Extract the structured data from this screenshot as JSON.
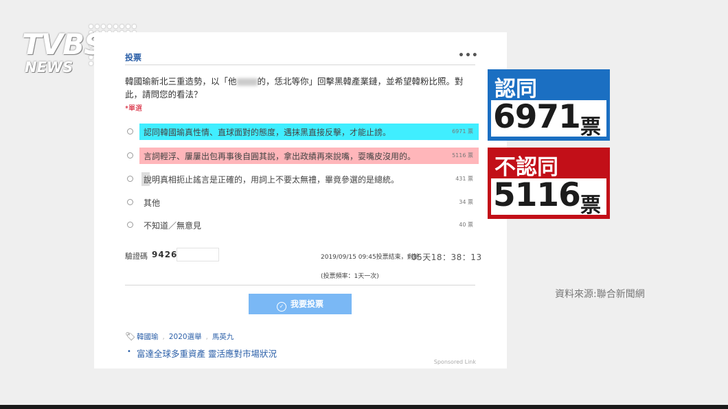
{
  "logo": {
    "top": "TVBS",
    "bottom": "NEWS"
  },
  "poll": {
    "title": "投票",
    "more_icon": "more-icon",
    "question_part1": "韓國瑜新北三重造勢，以「他",
    "question_part2": "的，恁北等你」回擊黑韓產業鏈，並希望韓粉比照。對此，請問您的看法？",
    "single_choice_note": "*單選",
    "options": [
      {
        "label": "認同韓國瑜真性情、直球面對的態度，遇抹黑直接反擊，才能止謗。",
        "count": "6971 票"
      },
      {
        "label": "言詞輕浮、屢屢出包再事後自圓其說，拿出政績再來說嘴，耍嘴皮沒用的。",
        "count": "5116 票"
      },
      {
        "label": "說明真相扼止謠言是正確的，用詞上不要太無禮，畢竟參選的是總統。",
        "count": "431 票"
      },
      {
        "label": "其他",
        "count": "34 票"
      },
      {
        "label": "不知道／無意見",
        "count": "40 票"
      }
    ],
    "verify_label": "驗證碼",
    "verify_code": "9426",
    "end_info": "2019/09/15 09:45投票結束，剩餘",
    "countdown": "05天18：38：13",
    "frequency": "(投票頻率：1天一次)",
    "vote_button": "我要投票",
    "vote_icon_glyph": "✓",
    "tags": [
      "韓國瑜",
      "2020選舉",
      "馬英九"
    ],
    "sponsored_bullet": "•",
    "sponsored_text": "富達全球多重資產 靈活應對市場狀況",
    "sponsored_link": "Sponsored Link"
  },
  "results": {
    "agree": {
      "heading": "認同",
      "number": "6971",
      "unit": "票",
      "color": "#1b6fc2"
    },
    "disagree": {
      "heading": "不認同",
      "number": "5116",
      "unit": "票",
      "color": "#c20f18"
    }
  },
  "source": "資料來源:聯合新聞網",
  "colors": {
    "highlight_agree": "#00e8ff",
    "highlight_disagree": "#ff9ea3",
    "link_blue": "#2b5fa8",
    "button_blue": "#7ab8f5"
  }
}
